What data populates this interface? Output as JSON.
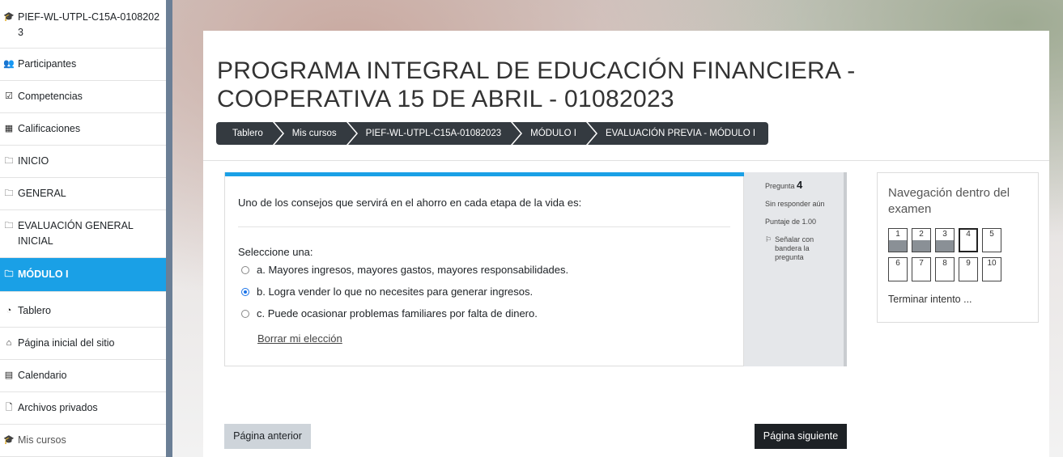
{
  "sidebar": {
    "items": [
      {
        "label": "PIEF-WL-UTPL-C15A-01082023",
        "icon": "graduation-cap-icon"
      },
      {
        "label": "Participantes",
        "icon": "users-icon"
      },
      {
        "label": "Competencias",
        "icon": "check-square-icon"
      },
      {
        "label": "Calificaciones",
        "icon": "table-icon"
      },
      {
        "label": "INICIO",
        "icon": "folder-icon"
      },
      {
        "label": "GENERAL",
        "icon": "folder-icon"
      },
      {
        "label": "EVALUACIÓN GENERAL INICIAL",
        "icon": "folder-icon"
      },
      {
        "label": "MÓDULO I",
        "icon": "folder-icon",
        "active": true
      },
      {
        "label": "Tablero",
        "icon": "dashboard-icon"
      },
      {
        "label": "Página inicial del sitio",
        "icon": "home-icon"
      },
      {
        "label": "Calendario",
        "icon": "calendar-icon"
      },
      {
        "label": "Archivos privados",
        "icon": "file-icon"
      },
      {
        "label": "Mis cursos",
        "icon": "graduation-cap-icon"
      }
    ]
  },
  "header": {
    "title": "PROGRAMA INTEGRAL DE EDUCACIÓN FINANCIERA - COOPERATIVA 15 DE ABRIL - 01082023",
    "breadcrumb": [
      "Tablero",
      "Mis cursos",
      "PIEF-WL-UTPL-C15A-01082023",
      "MÓDULO I",
      "EVALUACIÓN PREVIA - MÓDULO I"
    ]
  },
  "question": {
    "text": "Uno de los consejos que servirá en el ahorro en cada etapa de la vida es:",
    "prompt": "Seleccione una:",
    "options": [
      {
        "label": "a. Mayores ingresos, mayores gastos, mayores responsabilidades.",
        "checked": false
      },
      {
        "label": "b. Logra vender lo que no necesites para generar ingresos.",
        "checked": true
      },
      {
        "label": "c. Puede ocasionar problemas familiares por falta de dinero.",
        "checked": false
      }
    ],
    "clear_label": "Borrar mi elección"
  },
  "info": {
    "question_label": "Pregunta",
    "question_number": "4",
    "status": "Sin responder aún",
    "score": "Puntaje de 1.00",
    "flag_label": "Señalar con bandera la pregunta"
  },
  "quiz_nav": {
    "title": "Navegación dentro del examen",
    "buttons": [
      {
        "label": "1",
        "answered": true
      },
      {
        "label": "2",
        "answered": true
      },
      {
        "label": "3",
        "answered": true
      },
      {
        "label": "4",
        "current": true
      },
      {
        "label": "5"
      },
      {
        "label": "6"
      },
      {
        "label": "7"
      },
      {
        "label": "8"
      },
      {
        "label": "9"
      },
      {
        "label": "10"
      }
    ],
    "finish_label": "Terminar intento ..."
  },
  "footer": {
    "prev_label": "Página anterior",
    "next_label": "Página siguiente"
  },
  "colors": {
    "accent": "#1aa0e6",
    "dark": "#1d2125"
  }
}
